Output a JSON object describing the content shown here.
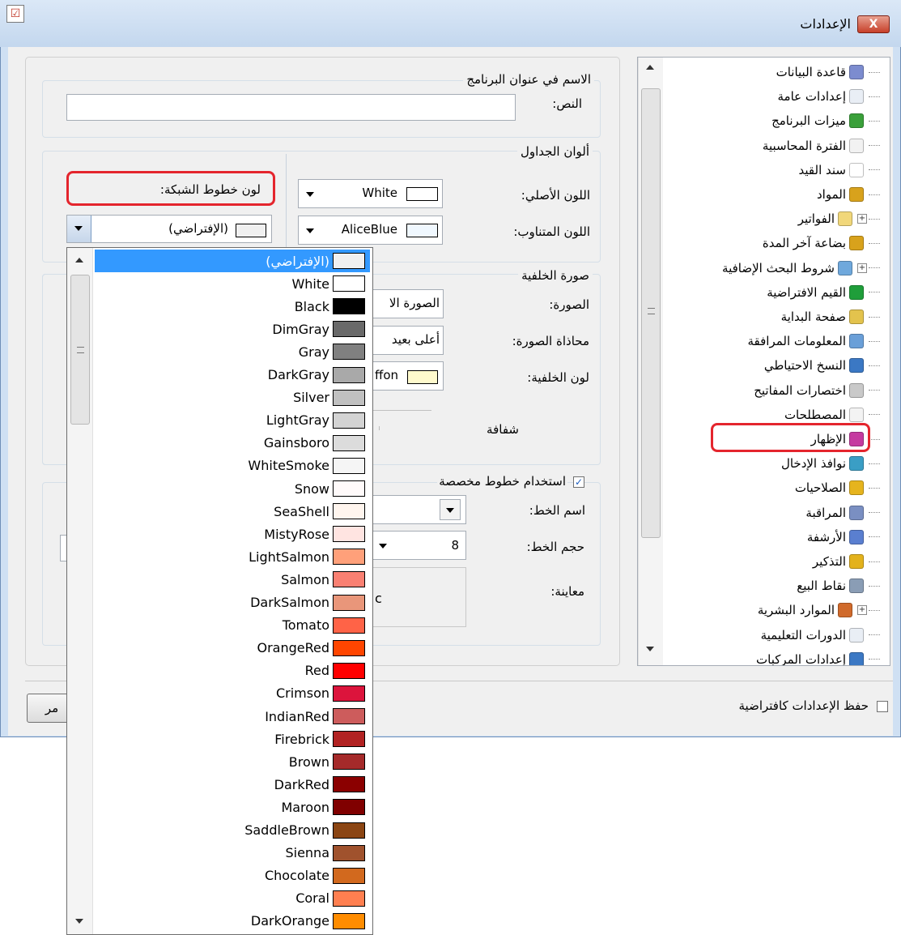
{
  "window": {
    "title": "الإعدادات",
    "close_label": "X",
    "app_icon": "checklist-icon"
  },
  "app_name": {
    "group_title": "الاسم في عنوان البرنامج",
    "text_label": "النص:",
    "text_value": ""
  },
  "table_colors": {
    "group_title": "ألوان الجداول",
    "original_label": "اللون الأصلي:",
    "original_value": "White",
    "original_color": "#ffffff",
    "alternate_label": "اللون المتناوب:",
    "alternate_value": "AliceBlue",
    "alternate_color": "#f0f8ff",
    "grid_label": "لون خطوط الشبكة:",
    "grid_value": "(الإفتراضي)",
    "grid_color": "#f0f0f0"
  },
  "background": {
    "group_title": "صورة الخلفية",
    "image_label": "الصورة:",
    "image_value": "الصورة الا",
    "align_label": "محاذاة الصورة:",
    "align_value": "أعلى بعيد",
    "color_label": "لون الخلفية:",
    "color_value": "ffon",
    "color_swatch": "#fffacd",
    "opacity_label": "شفافة"
  },
  "fonts": {
    "checkbox_label": "استخدام خطوط مخصصة",
    "checked": true,
    "name_label": "اسم الخط:",
    "size_label": "حجم الخط:",
    "size_value": "8",
    "preview_label": "معاينة:",
    "preview_text": "c"
  },
  "bottom": {
    "save_default_label": "حفظ الإعدادات كافتراضية",
    "button_label": "مر"
  },
  "tree": {
    "items": [
      {
        "label": "قاعدة البيانات",
        "icon": "database-icon",
        "color": "#7c8ccf",
        "expand": false
      },
      {
        "label": "إعدادات عامة",
        "icon": "checklist-icon",
        "color": "#e9eef5",
        "expand": false
      },
      {
        "label": "ميزات البرنامج",
        "icon": "puzzle-icon",
        "color": "#3aa03a",
        "expand": false
      },
      {
        "label": "الفترة المحاسبية",
        "icon": "calendar-icon",
        "color": "#f2f2f2",
        "expand": false
      },
      {
        "label": "سند القيد",
        "icon": "document-icon",
        "color": "#ffffff",
        "expand": false
      },
      {
        "label": "المواد",
        "icon": "box-icon",
        "color": "#d8a21c",
        "expand": false
      },
      {
        "label": "الفواتير",
        "icon": "invoice-icon",
        "color": "#f1d77a",
        "expand": true
      },
      {
        "label": "بضاعة آخر المدة",
        "icon": "box-icon",
        "color": "#d8a21c",
        "expand": false
      },
      {
        "label": "شروط البحث الإضافية",
        "icon": "search-icon",
        "color": "#6fa8dc",
        "expand": true
      },
      {
        "label": "القيم الافتراضية",
        "icon": "check-circle-icon",
        "color": "#1f9e3a",
        "expand": false
      },
      {
        "label": "صفحة البداية",
        "icon": "brush-icon",
        "color": "#e3c34d",
        "expand": false
      },
      {
        "label": "المعلومات المرافقة",
        "icon": "info-icon",
        "color": "#6a9fd8",
        "expand": false
      },
      {
        "label": "النسخ الاحتياطي",
        "icon": "backup-icon",
        "color": "#3b78c4",
        "expand": false
      },
      {
        "label": "اختصارات المفاتيح",
        "icon": "keyboard-icon",
        "color": "#c9c9c9",
        "expand": false
      },
      {
        "label": "المصطلحات",
        "icon": "list-icon",
        "color": "#f3f3f3",
        "expand": false
      },
      {
        "label": "الإظهار",
        "icon": "display-icon",
        "color": "#c53aa0",
        "expand": false
      },
      {
        "label": "نوافذ الإدخال",
        "icon": "edit-icon",
        "color": "#3a9ec5",
        "expand": false
      },
      {
        "label": "الصلاحيات",
        "icon": "lock-icon",
        "color": "#e6b41e",
        "expand": false
      },
      {
        "label": "المراقبة",
        "icon": "monitor-icon",
        "color": "#7a8fc2",
        "expand": false
      },
      {
        "label": "الأرشفة",
        "icon": "paperclip-icon",
        "color": "#5a7fd0",
        "expand": false
      },
      {
        "label": "التذكير",
        "icon": "bell-icon",
        "color": "#e3b21c",
        "expand": false
      },
      {
        "label": "نقاط البيع",
        "icon": "pos-icon",
        "color": "#8a9db5",
        "expand": false
      },
      {
        "label": "الموارد البشرية",
        "icon": "people-icon",
        "color": "#d06a2b",
        "expand": true
      },
      {
        "label": "الدورات التعليمية",
        "icon": "checklist-icon",
        "color": "#e9eef5",
        "expand": false
      },
      {
        "label": "إعدادات المركبات",
        "icon": "car-icon",
        "color": "#3b78c4",
        "expand": false
      }
    ]
  },
  "color_list": [
    {
      "name": "(الإفتراضي)",
      "hex": "#f0f0f0"
    },
    {
      "name": "White",
      "hex": "#ffffff"
    },
    {
      "name": "Black",
      "hex": "#000000"
    },
    {
      "name": "DimGray",
      "hex": "#696969"
    },
    {
      "name": "Gray",
      "hex": "#808080"
    },
    {
      "name": "DarkGray",
      "hex": "#a9a9a9"
    },
    {
      "name": "Silver",
      "hex": "#c0c0c0"
    },
    {
      "name": "LightGray",
      "hex": "#d3d3d3"
    },
    {
      "name": "Gainsboro",
      "hex": "#dcdcdc"
    },
    {
      "name": "WhiteSmoke",
      "hex": "#f5f5f5"
    },
    {
      "name": "Snow",
      "hex": "#fffafa"
    },
    {
      "name": "SeaShell",
      "hex": "#fff5ee"
    },
    {
      "name": "MistyRose",
      "hex": "#ffe4e1"
    },
    {
      "name": "LightSalmon",
      "hex": "#ffa07a"
    },
    {
      "name": "Salmon",
      "hex": "#fa8072"
    },
    {
      "name": "DarkSalmon",
      "hex": "#e9967a"
    },
    {
      "name": "Tomato",
      "hex": "#ff6347"
    },
    {
      "name": "OrangeRed",
      "hex": "#ff4500"
    },
    {
      "name": "Red",
      "hex": "#ff0000"
    },
    {
      "name": "Crimson",
      "hex": "#dc143c"
    },
    {
      "name": "IndianRed",
      "hex": "#cd5c5c"
    },
    {
      "name": "Firebrick",
      "hex": "#b22222"
    },
    {
      "name": "Brown",
      "hex": "#a52a2a"
    },
    {
      "name": "DarkRed",
      "hex": "#8b0000"
    },
    {
      "name": "Maroon",
      "hex": "#800000"
    },
    {
      "name": "SaddleBrown",
      "hex": "#8b4513"
    },
    {
      "name": "Sienna",
      "hex": "#a0522d"
    },
    {
      "name": "Chocolate",
      "hex": "#d2691e"
    },
    {
      "name": "Coral",
      "hex": "#ff7f50"
    },
    {
      "name": "DarkOrange",
      "hex": "#ff8c00"
    }
  ],
  "selected_color": "(الإفتراضي)",
  "highlight_color": "#e4252d"
}
